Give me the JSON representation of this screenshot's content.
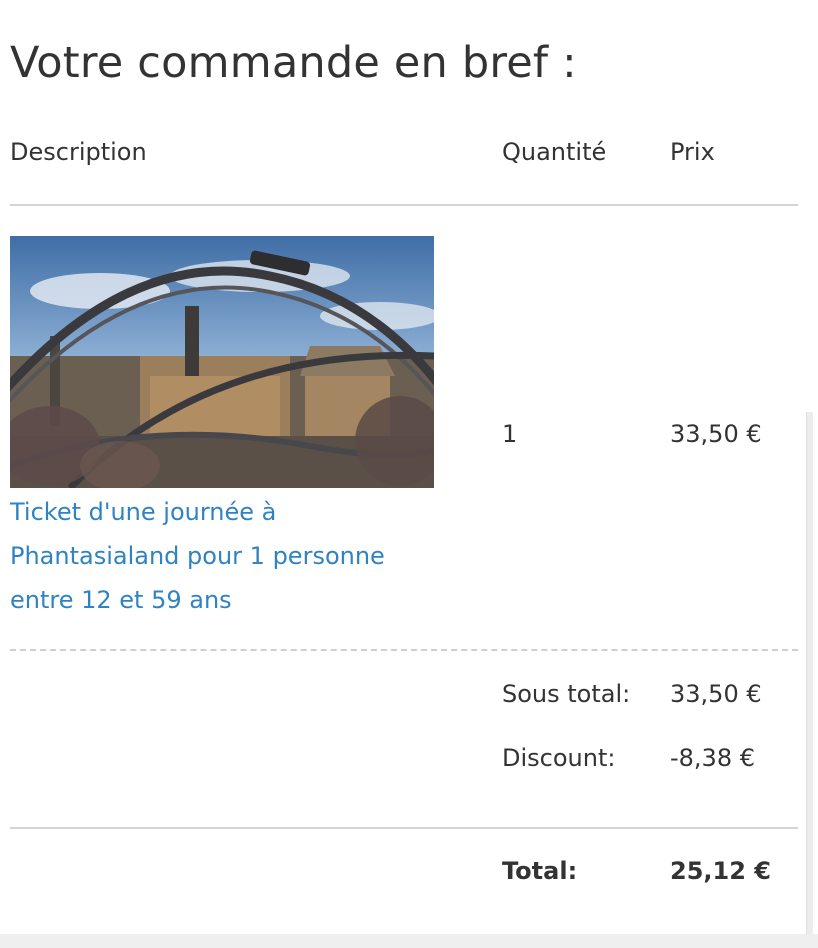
{
  "order_summary": {
    "title": "Votre commande en bref :",
    "columns": {
      "description": "Description",
      "quantity": "Quantité",
      "price": "Prix"
    },
    "items": [
      {
        "name": "Ticket d'une journée à Phantasialand pour 1 personne entre 12 et 59 ans",
        "image": "roller-coaster-photo",
        "quantity": "1",
        "price": "33,50 €"
      }
    ],
    "totals": {
      "subtotal_label": "Sous total:",
      "subtotal_value": "33,50 €",
      "discount_label": "Discount:",
      "discount_value": "-8,38 €",
      "total_label": "Total:",
      "total_value": "25,12 €"
    }
  },
  "colors": {
    "text": "#333333",
    "link": "#2f83c2",
    "rule": "#d4d4d4"
  }
}
